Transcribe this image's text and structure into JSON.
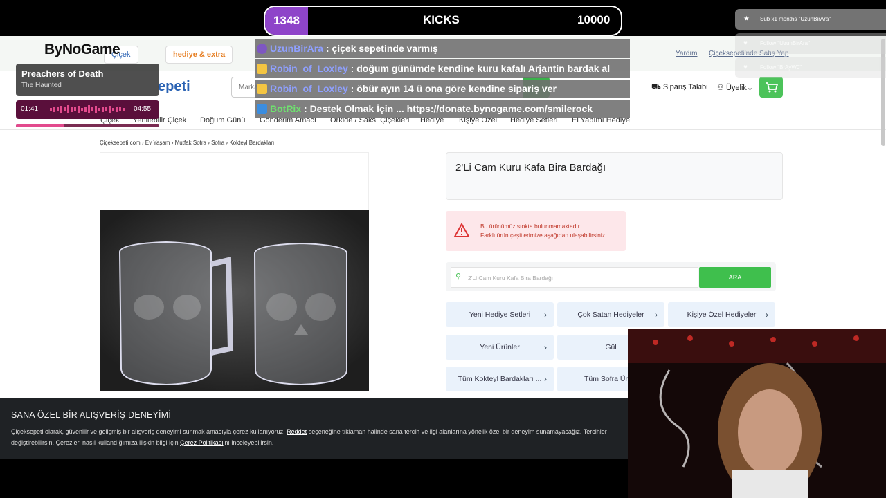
{
  "stream": {
    "kicks_count": "1348",
    "kicks_label": "KICKS",
    "kicks_goal": "10000",
    "brand": "ByNoGame",
    "song_title": "Preachers of Death",
    "song_artist": "The Haunted",
    "time_elapsed": "01:41",
    "time_total": "04:55",
    "progress_fraction": 0.34,
    "chat": [
      {
        "user": "UzunBirAra",
        "message": " : çiçek sepetinde varmış",
        "badge_color": "#7e57c2"
      },
      {
        "user": "Robin_of_Loxley",
        "message": " : doğum günümde kendine kuru kafalı Arjantin bardak al",
        "badge_color": "#f4c542"
      },
      {
        "user": "Robin_of_Loxley",
        "message": " : öbür ayın 14 ü ona göre kendine sipariş ver",
        "badge_color": "#f4c542"
      },
      {
        "user": "BotRix",
        "message": " : Destek Olmak İçin ... https://donate.bynogame.com/smilerock",
        "badge_color": "#3b8de0"
      }
    ],
    "feed": [
      {
        "text": "Sub x1 months \"UzunBirAra\"",
        "icon": "star-icon"
      },
      {
        "text": "Follow \"UzunBirAra\"",
        "icon": "heart-icon"
      },
      {
        "text": "Follow \"BrAyW0\"",
        "icon": "heart-icon"
      }
    ]
  },
  "site": {
    "top_chips": [
      "Çiçek",
      "hediye & extra"
    ],
    "top_links": [
      "Yardım",
      "Çiçeksepeti'nde Satış Yap"
    ],
    "logo": "epeti",
    "search_placeholder": "Marka",
    "header_links": [
      "Sipariş Takibi",
      "Üyelik"
    ],
    "nav": [
      "Çiçek",
      "Yenilebilir Çiçek",
      "Doğum Günü",
      "Gönderim Amacı",
      "Orkide / Saksı Çiçekleri",
      "Hediye",
      "Kişiye Özel",
      "Hediye Setleri",
      "El Yapımı Hediye"
    ],
    "breadcrumb": "Çiçeksepeti.com  ›  Ev Yaşam  ›  Mutfak Sofra  ›  Sofra  ›  Kokteyl Bardakları",
    "product_title": "2'Li Cam Kuru Kafa Bira Bardağı",
    "warning_line1": "Bu ürünümüz stokta bulunmamaktadır.",
    "warning_line2": "Farklı ürün çeşitlerimize aşağıdan ulaşabilirsiniz.",
    "search_value": "2'Li Cam Kuru Kafa Bira Bardağı",
    "search_button": "ARA",
    "categories": [
      "Yeni Hediye Setleri",
      "Çok Satan Hediyeler",
      "Kişiye Özel Hediyeler",
      "Yeni Ürünler",
      "Gül",
      "Tüm Kokteyl Bardakları ...",
      "Tüm Sofra Ürünl"
    ],
    "cookie_title": "SANA ÖZEL BİR ALIŞVERİŞ DENEYİMİ",
    "cookie_line1_a": "Çiçeksepeti olarak, güvenilir ve gelişmiş bir alışveriş deneyimi sunmak amacıyla çerez kullanıyoruz. ",
    "cookie_line1_link": "Reddet",
    "cookie_line1_b": " seçeneğine tıklaman halinde sana tercih ve ilgi alanlarına yönelik özel bir deneyim sunamayacağız. Tercihler",
    "cookie_line2_a": "değiştirebilirsin. Çerezleri nasıl kullandığımıza ilişkin bilgi için ",
    "cookie_line2_link": "Çerez Politikası",
    "cookie_line2_b": "'nı inceleyebilirsin."
  }
}
